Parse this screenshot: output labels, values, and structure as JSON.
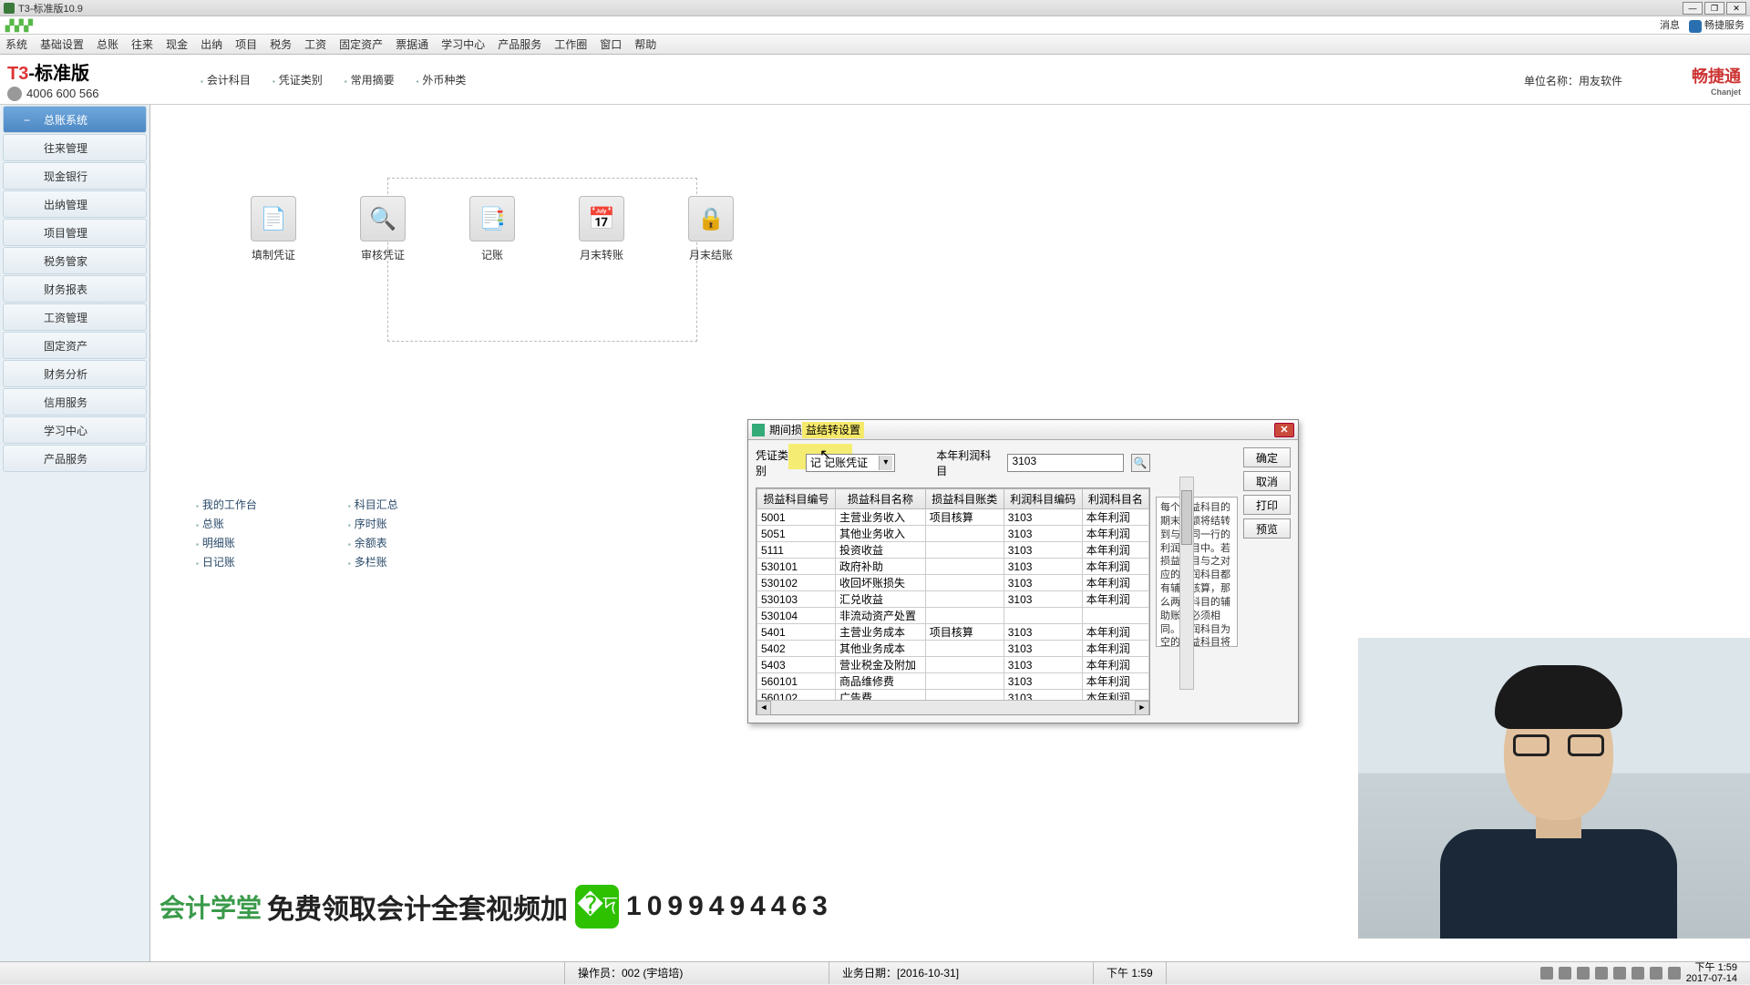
{
  "window": {
    "title": "T3-标准版10.9"
  },
  "top": {
    "msg": "消息",
    "svc": "畅捷服务"
  },
  "menu": [
    "系统",
    "基础设置",
    "总账",
    "往来",
    "现金",
    "出纳",
    "项目",
    "税务",
    "工资",
    "固定资产",
    "票据通",
    "学习中心",
    "产品服务",
    "工作圈",
    "窗口",
    "帮助"
  ],
  "toolbar": {
    "brand": "T3-标准版",
    "phone": "4006 600 566",
    "quick": [
      "会计科目",
      "凭证类别",
      "常用摘要",
      "外币种类"
    ],
    "unit": "单位名称：用友软件",
    "cjt": "畅捷通",
    "cjt_sub": "Chanjet"
  },
  "sidebar": [
    "总账系统",
    "往来管理",
    "现金银行",
    "出纳管理",
    "项目管理",
    "税务管家",
    "财务报表",
    "工资管理",
    "固定资产",
    "财务分析",
    "信用服务",
    "学习中心",
    "产品服务"
  ],
  "flow": [
    "填制凭证",
    "审核凭证",
    "记账",
    "月末转账",
    "月末结账"
  ],
  "links": {
    "col1": [
      "我的工作台",
      "总账",
      "明细账",
      "日记账"
    ],
    "col2": [
      "科目汇总",
      "序时账",
      "余额表",
      "多栏账"
    ]
  },
  "dialog": {
    "title_a": "期间损",
    "title_b": "益结转设置",
    "voucher_type_label": "凭证类别",
    "voucher_type_value": "记 记账凭证",
    "profit_subject_label": "本年利润科目",
    "profit_subject_value": "3103",
    "btns": {
      "ok": "确定",
      "cancel": "取消",
      "print": "打印",
      "preview": "预览"
    },
    "headers": [
      "损益科目编号",
      "损益科目名称",
      "损益科目账类",
      "利润科目编码",
      "利润科目名"
    ],
    "rows": [
      {
        "c0": "5001",
        "c1": "主营业务收入",
        "c2": "项目核算",
        "c3": "3103",
        "c4": "本年利润"
      },
      {
        "c0": "5051",
        "c1": "其他业务收入",
        "c2": "",
        "c3": "3103",
        "c4": "本年利润"
      },
      {
        "c0": "5111",
        "c1": "投资收益",
        "c2": "",
        "c3": "3103",
        "c4": "本年利润"
      },
      {
        "c0": "530101",
        "c1": "政府补助",
        "c2": "",
        "c3": "3103",
        "c4": "本年利润"
      },
      {
        "c0": "530102",
        "c1": "收回坏账损失",
        "c2": "",
        "c3": "3103",
        "c4": "本年利润"
      },
      {
        "c0": "530103",
        "c1": "汇兑收益",
        "c2": "",
        "c3": "3103",
        "c4": "本年利润"
      },
      {
        "c0": "530104",
        "c1": "非流动资产处置",
        "c2": "",
        "c3": "",
        "c4": ""
      },
      {
        "c0": "5401",
        "c1": "主营业务成本",
        "c2": "项目核算",
        "c3": "3103",
        "c4": "本年利润"
      },
      {
        "c0": "5402",
        "c1": "其他业务成本",
        "c2": "",
        "c3": "3103",
        "c4": "本年利润"
      },
      {
        "c0": "5403",
        "c1": "营业税金及附加",
        "c2": "",
        "c3": "3103",
        "c4": "本年利润"
      },
      {
        "c0": "560101",
        "c1": "商品维修费",
        "c2": "",
        "c3": "3103",
        "c4": "本年利润"
      },
      {
        "c0": "560102",
        "c1": "广告费",
        "c2": "",
        "c3": "3103",
        "c4": "本年利润"
      }
    ],
    "help": "每个损益科目的期末余额将结转到与其同一行的利润科目中。若损益科目与之对应的利润科目都有辅助核算，那么两个科目的辅助账类必须相同。利润科目为空的损益科目将不参与期间损益结转"
  },
  "wm": {
    "brand": "会计学堂",
    "txt": "免费领取会计全套视频加",
    "num": "1099494463"
  },
  "status": {
    "operator": "操作员：002 (宇培培)",
    "bizdate": "业务日期：[2016-10-31]",
    "time": "下午 1:59",
    "clock_t": "下午 1:59",
    "clock_d": "2017-07-14"
  }
}
